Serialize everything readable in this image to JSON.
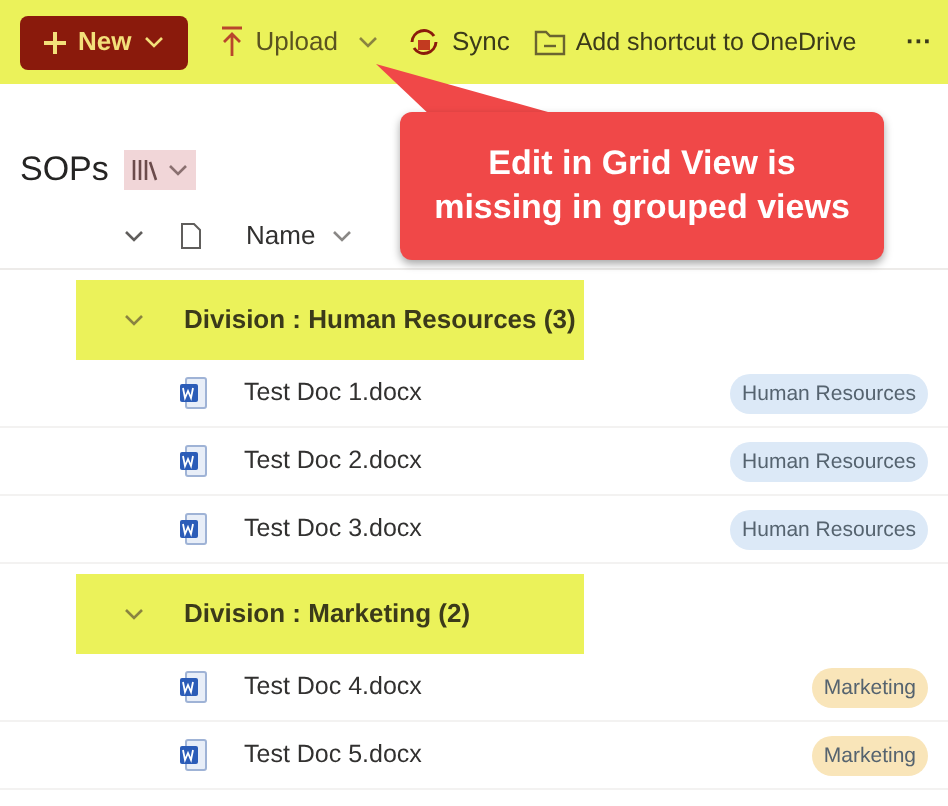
{
  "toolbar": {
    "items": [
      {
        "kind": "new",
        "label": "New"
      },
      {
        "kind": "upload",
        "label": "Upload"
      },
      {
        "kind": "sync",
        "label": "Sync"
      },
      {
        "kind": "shortcut",
        "label": "Add shortcut to OneDrive"
      },
      {
        "kind": "more",
        "label": "···"
      }
    ]
  },
  "library": {
    "title": "SOPs"
  },
  "callout": {
    "text": "Edit in Grid View is missing in grouped views"
  },
  "table": {
    "columns": [
      {
        "label": "Name"
      }
    ],
    "groups": [
      {
        "label": "Division : Human Resources (3)",
        "expanded": true,
        "rows": [
          {
            "name": "Test Doc 1.docx",
            "tag": "Human Resources",
            "color": "#dce9f7"
          },
          {
            "name": "Test Doc 2.docx",
            "tag": "Human Resources",
            "color": "#dce9f7"
          },
          {
            "name": "Test Doc 3.docx",
            "tag": "Human Resources",
            "color": "#dce9f7"
          }
        ]
      },
      {
        "label": "Division : Marketing (2)",
        "expanded": true,
        "rows": [
          {
            "name": "Test Doc 4.docx",
            "tag": "Marketing",
            "color": "#f9e5b9"
          },
          {
            "name": "Test Doc 5.docx",
            "tag": "Marketing",
            "color": "#f9e5b9"
          }
        ]
      }
    ]
  }
}
